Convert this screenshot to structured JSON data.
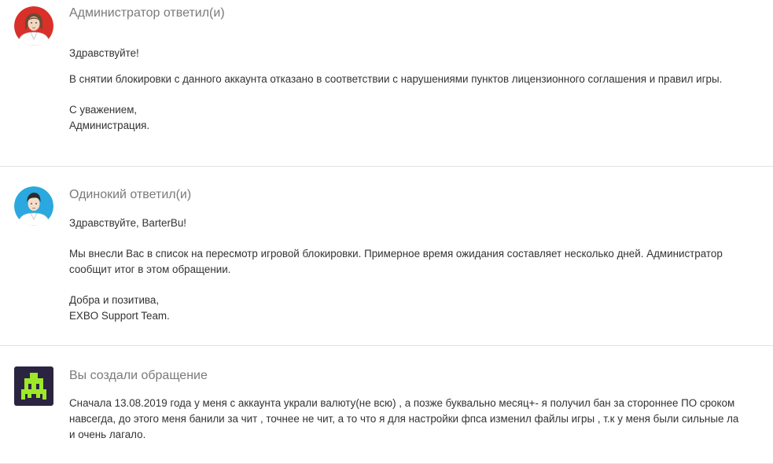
{
  "messages": [
    {
      "author": "Администратор ответил(и)",
      "avatar_icon": "admin-avatar-icon",
      "greeting": "Здравствуйте!",
      "paragraph": "В снятии блокировки с данного аккаунта отказано в соответствии с нарушениями пунктов лицензионного соглашения и правил игры.",
      "sign_1": "С уважением,",
      "sign_2": "Администрация."
    },
    {
      "author": "Одинокий ответил(и)",
      "avatar_icon": "support-avatar-icon",
      "greeting": "Здравствуйте, BarterBu!",
      "paragraph_line_1": "Мы внесли Вас в список на пересмотр игровой блокировки. Примерное время ожидания составляет несколько дней. Администратор",
      "paragraph_line_2": "сообщит итог в этом обращении.",
      "sign_1": "Добра и позитива,",
      "sign_2": "EXBO Support Team."
    },
    {
      "author": "Вы создали обращение",
      "avatar_icon": "space-invader-avatar-icon",
      "line_1": "Сначала 13.08.2019 года у меня с аккаунта украли валюту(не всю) , а позже буквально месяц+- я получил бан за стороннее ПО сроком",
      "line_2": "навсегда, до этого меня банили за чит , точнее не чит, а то что я для настройки фпса изменил файлы игры , т.к у меня были сильные ла",
      "line_3": "и очень лагало."
    }
  ],
  "colors": {
    "author_text": "#7a7a7a",
    "body_text": "#333333",
    "divider": "#e2e2e2",
    "admin_avatar_bg": "#d9302a",
    "support_avatar_bg": "#2aa8df",
    "user_avatar_bg": "#2b2440",
    "invader_green": "#9ee82a"
  }
}
